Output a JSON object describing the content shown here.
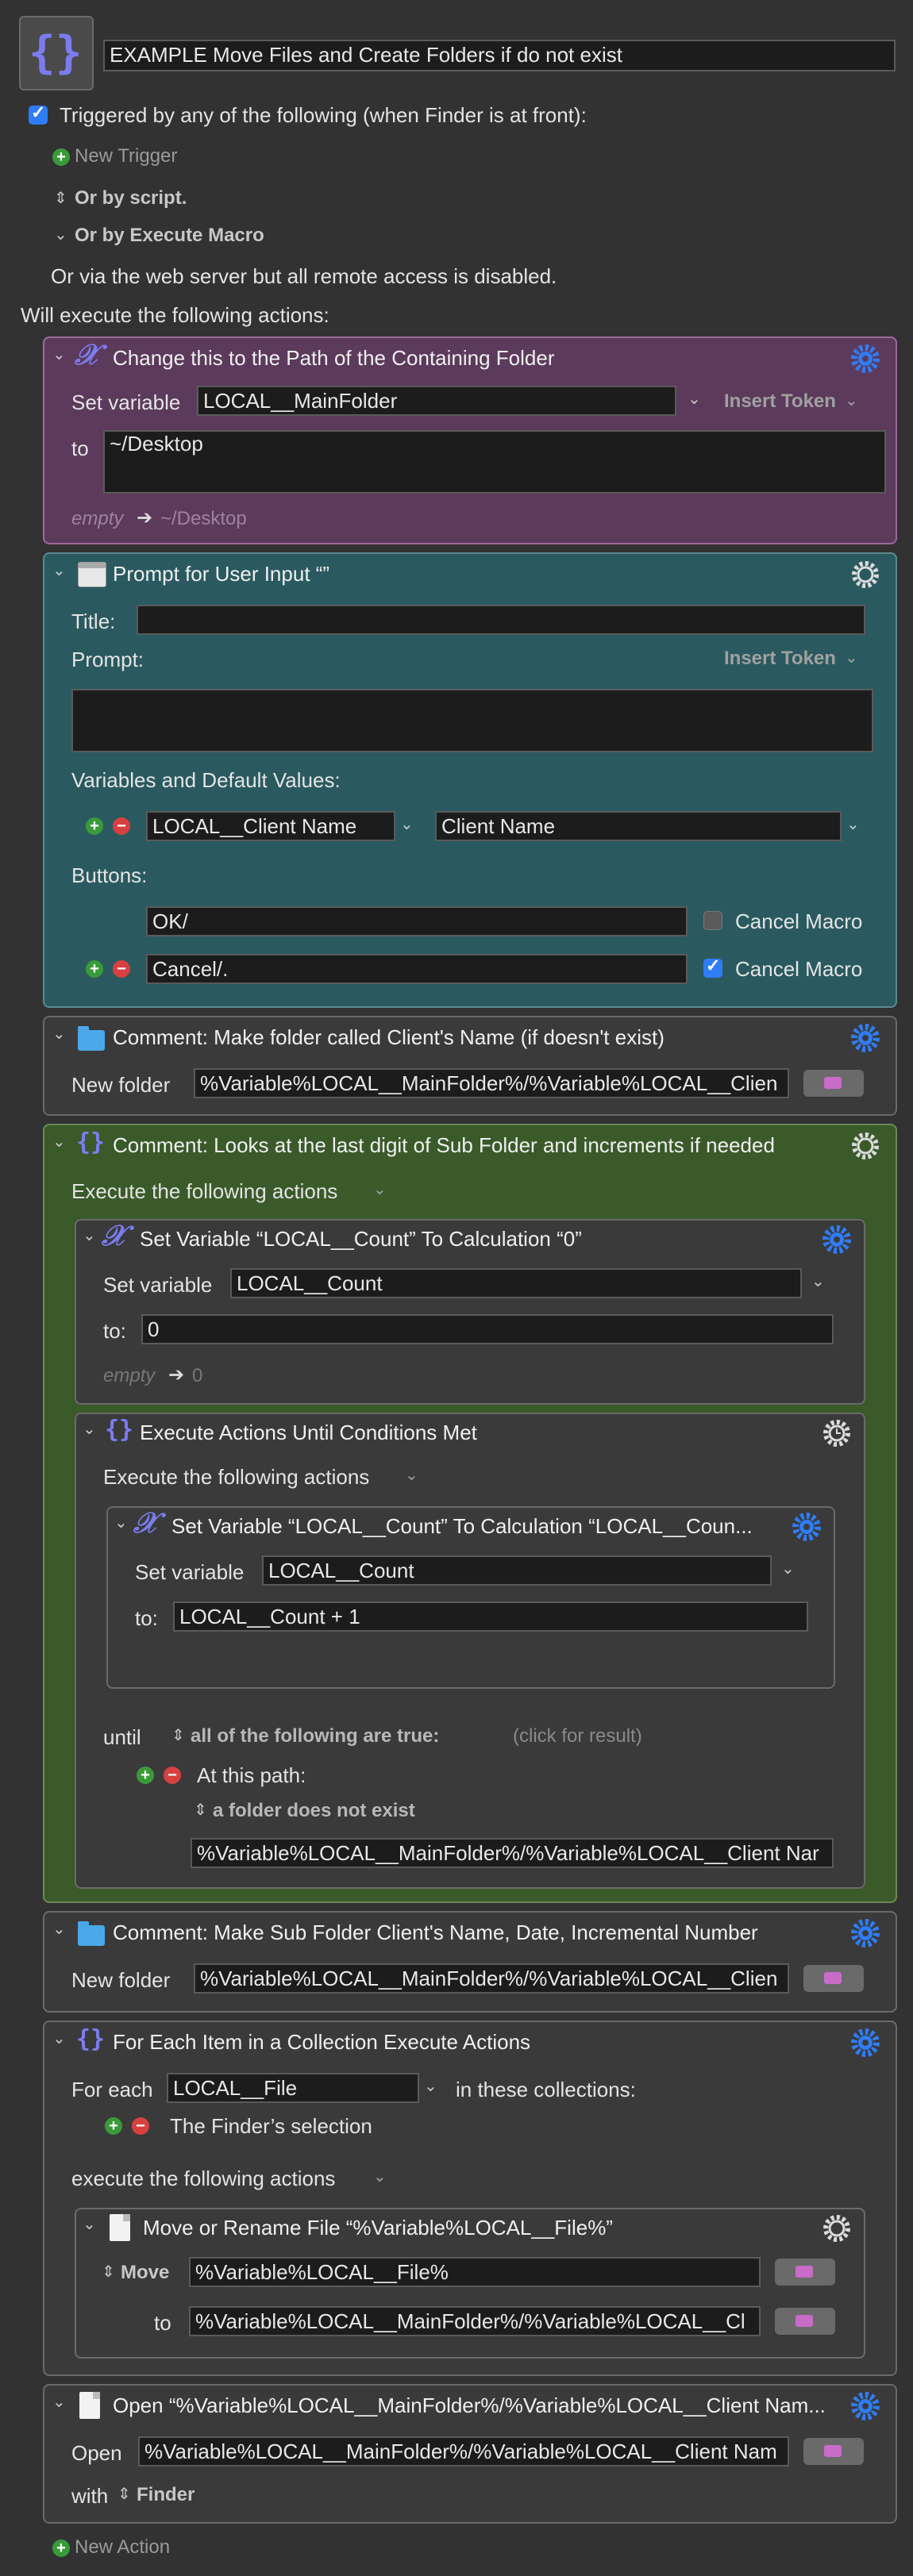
{
  "macro_title": "EXAMPLE Move Files and Create Folders if do not exist",
  "trigger_label": "Triggered by any of the following (when Finder is at front):",
  "new_trigger": "New Trigger",
  "or_by_script": "Or by script.",
  "or_by_execute": "Or by Execute Macro",
  "web_server_note": "Or via the web server but all remote access is disabled.",
  "will_execute": "Will execute the following actions:",
  "insert_token": "Insert Token",
  "action1": {
    "title": "Change this to the Path of the Containing Folder",
    "set_variable_label": "Set variable",
    "variable": "LOCAL__MainFolder",
    "to_label": "to",
    "value": "~/Desktop",
    "preview_empty": "empty",
    "preview_value": "~/Desktop"
  },
  "action2": {
    "title": "Prompt for User Input “”",
    "title_label": "Title:",
    "prompt_label": "Prompt:",
    "vars_label": "Variables and Default Values:",
    "variable": "LOCAL__Client Name",
    "default_value": "Client Name",
    "buttons_label": "Buttons:",
    "button1": "OK/",
    "button2": "Cancel/.",
    "cancel_macro": "Cancel Macro"
  },
  "action3": {
    "title": "Comment: Make folder called Client's Name (if doesn't exist)",
    "new_folder_label": "New folder",
    "path": "%Variable%LOCAL__MainFolder%/%Variable%LOCAL__Clien"
  },
  "action4": {
    "title": "Comment: Looks at the last digit of Sub Folder and increments if needed",
    "execute_label": "Execute the following actions",
    "sub1": {
      "title": "Set Variable “LOCAL__Count” To Calculation “0”",
      "set_variable_label": "Set variable",
      "variable": "LOCAL__Count",
      "to_label": "to:",
      "value": "0",
      "preview_empty": "empty",
      "preview_value": "0"
    },
    "sub2": {
      "title": "Execute Actions Until Conditions Met",
      "execute_label": "Execute the following actions",
      "inner": {
        "title": "Set Variable “LOCAL__Count” To Calculation “LOCAL__Coun...",
        "set_variable_label": "Set variable",
        "variable": "LOCAL__Count",
        "to_label": "to:",
        "value": "LOCAL__Count + 1"
      },
      "until_label": "until",
      "condition_mode": "all of the following are true:",
      "click_for_result": "(click for result)",
      "at_this_path": "At this path:",
      "folder_condition": "a folder does not exist",
      "path": "%Variable%LOCAL__MainFolder%/%Variable%LOCAL__Client Nar"
    }
  },
  "action5": {
    "title": "Comment: Make Sub Folder Client's Name, Date, Incremental Number",
    "new_folder_label": "New folder",
    "path": "%Variable%LOCAL__MainFolder%/%Variable%LOCAL__Clien"
  },
  "action6": {
    "title": "For Each Item in a Collection Execute Actions",
    "for_each_label": "For each",
    "variable": "LOCAL__File",
    "in_collections": "in these collections:",
    "collection": "The Finder’s selection",
    "execute_label": "execute the following actions",
    "sub": {
      "title": "Move or Rename File “%Variable%LOCAL__File%”",
      "move_label": "Move",
      "source": "%Variable%LOCAL__File%",
      "to_label": "to",
      "dest": "%Variable%LOCAL__MainFolder%/%Variable%LOCAL__Cl"
    }
  },
  "action7": {
    "title": "Open “%Variable%LOCAL__MainFolder%/%Variable%LOCAL__Client Nam...",
    "open_label": "Open",
    "path": "%Variable%LOCAL__MainFolder%/%Variable%LOCAL__Client Nam",
    "with_label": "with",
    "app": "Finder"
  },
  "new_action": "New Action",
  "colors": {
    "background": "#323232",
    "purple_action": "#5c3a5c",
    "teal_action": "#2a5a60",
    "green_group": "#3a5a2a",
    "accent_blue": "#2f7df6"
  }
}
